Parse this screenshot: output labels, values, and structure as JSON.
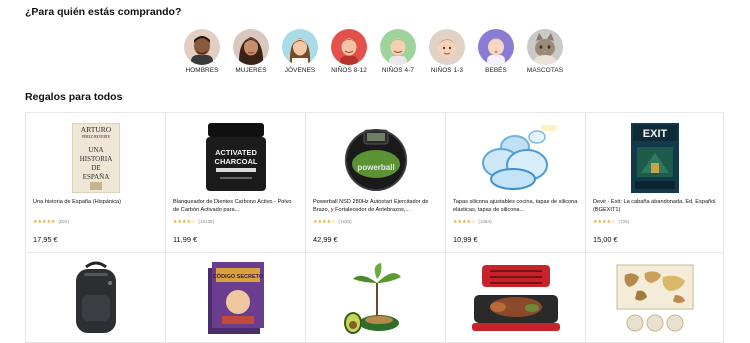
{
  "header": {
    "title": "¿Para quién estás comprando?"
  },
  "categories": [
    {
      "label": "HOMBRES",
      "icon": "man-avatar-icon",
      "bg": "#e3cfc2"
    },
    {
      "label": "MUJERES",
      "icon": "woman-avatar-icon",
      "bg": "#d9c8bf"
    },
    {
      "label": "JÓVENES",
      "icon": "teen-avatar-icon",
      "bg": "#a9dbe8"
    },
    {
      "label": "NIÑOS 8-12",
      "icon": "kid-avatar-icon",
      "bg": "#e3514a"
    },
    {
      "label": "NIÑOS 4-7",
      "icon": "child-avatar-icon",
      "bg": "#9ed49b"
    },
    {
      "label": "NIÑOS 1-3",
      "icon": "toddler-avatar-icon",
      "bg": "#e0d2c7"
    },
    {
      "label": "BEBÉS",
      "icon": "baby-avatar-icon",
      "bg": "#8a7bd3"
    },
    {
      "label": "MASCOTAS",
      "icon": "cat-avatar-icon",
      "bg": "#c9c9c9"
    }
  ],
  "section": {
    "title": "Regalos para todos"
  },
  "products": [
    {
      "title": "Una historia de España (Hispánica)",
      "stars": "★★★★★",
      "reviews": "(824)",
      "price": "17,95 €",
      "image": "book-cover-icon",
      "cover_text": [
        "ARTURO",
        "PÉREZ-REVERTE",
        "UNA",
        "HISTORIA",
        "DE",
        "ESPAÑA"
      ]
    },
    {
      "title": "Blanqueador de Dientes Carbono Activo - Polvo de Carbón Activado para...",
      "stars": "★★★★☆",
      "reviews": "(15135)",
      "price": "11,99 €",
      "image": "charcoal-jar-icon",
      "jar_text": [
        "ACTIVATED",
        "CHARCOAL"
      ]
    },
    {
      "title": "Powerball NSD 280Hz Autostart Ejercitador de Brazo, y Fortalecedor de Antebrazos,...",
      "stars": "★★★★☆",
      "reviews": "(1630)",
      "price": "42,99 €",
      "image": "powerball-icon",
      "ball_text": "powerball"
    },
    {
      "title": "Tapas silicona ajustables cocina, tapas de silicona elásticas, tapas de silicona...",
      "stars": "★★★★☆",
      "reviews": "(1064)",
      "price": "10,99 €",
      "image": "silicone-lids-icon"
    },
    {
      "title": "Devir - Exit: La cabaña abandonada, Ed. Español (BGEXIT1)",
      "stars": "★★★★☆",
      "reviews": "(725)",
      "price": "15,00 €",
      "image": "board-game-box-icon",
      "box_text": "EXIT"
    },
    {
      "title": "",
      "stars": "",
      "reviews": "",
      "price": "",
      "image": "backpack-icon"
    },
    {
      "title": "",
      "stars": "",
      "reviews": "",
      "price": "",
      "image": "card-game-box-icon",
      "box_text": "CÓDIGO SECRETO"
    },
    {
      "title": "",
      "stars": "",
      "reviews": "",
      "price": "",
      "image": "avocado-plant-icon"
    },
    {
      "title": "",
      "stars": "",
      "reviews": "",
      "price": "",
      "image": "grill-pan-icon"
    },
    {
      "title": "",
      "stars": "",
      "reviews": "",
      "price": "",
      "image": "scratch-map-icon"
    }
  ]
}
